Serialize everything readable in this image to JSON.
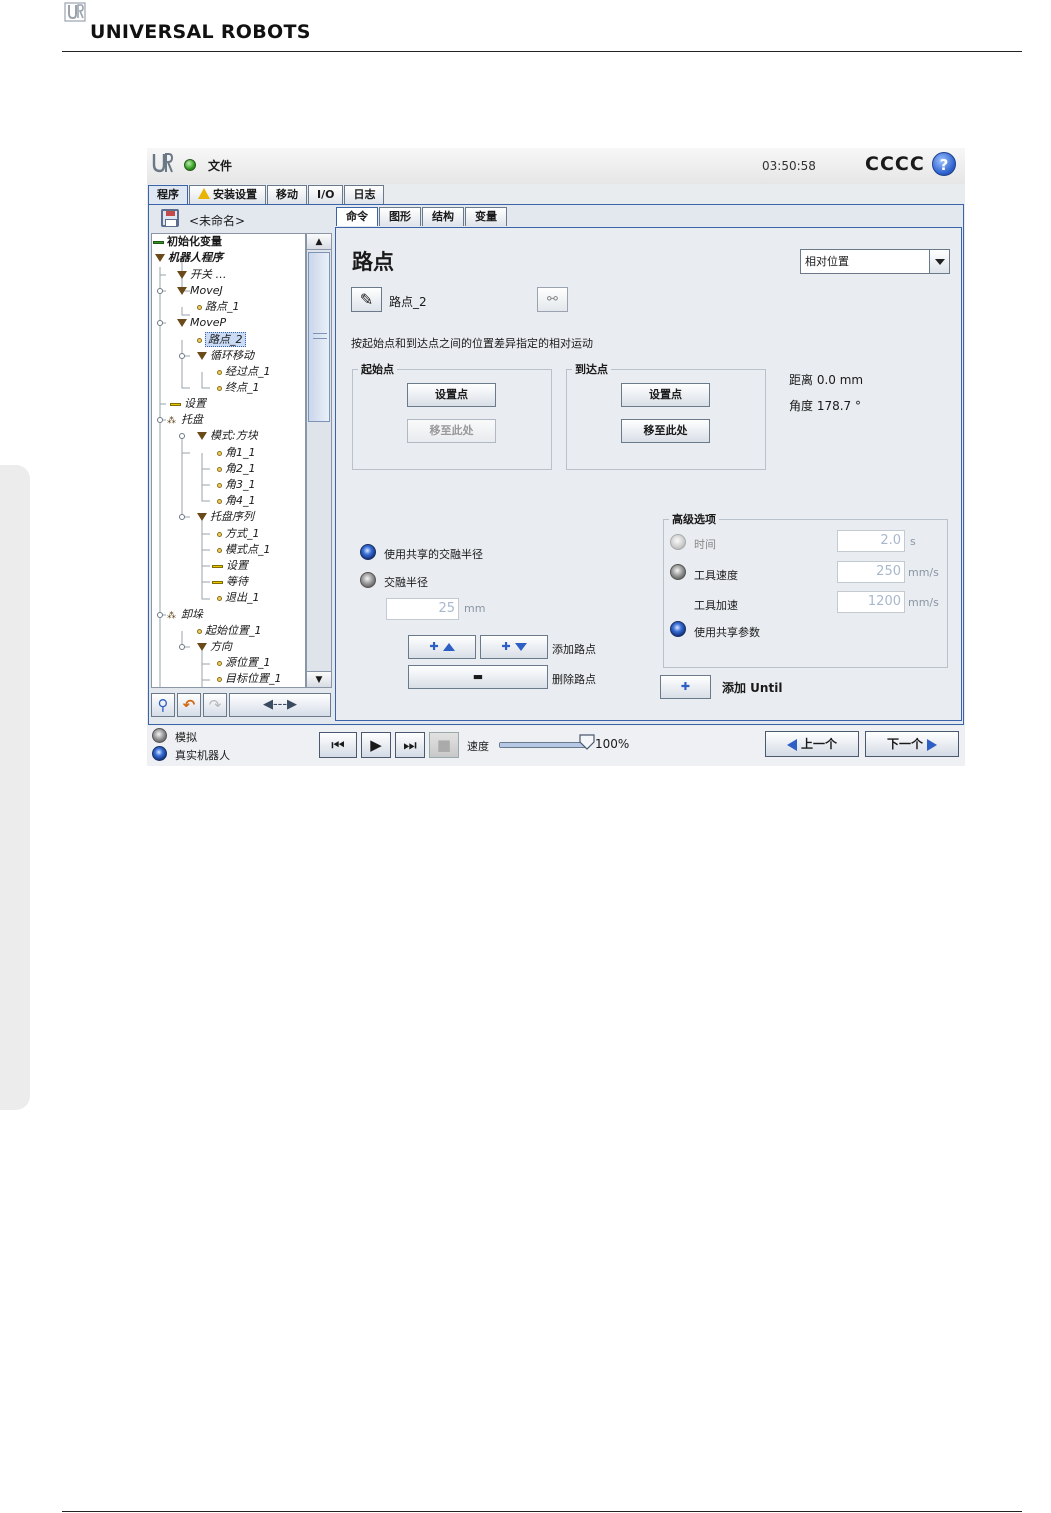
{
  "brand": {
    "name": "UNIVERSAL ROBOTS"
  },
  "titlebar": {
    "file_menu": "文件",
    "time": "03:50:58",
    "robot_name": "CCCC",
    "help": "?"
  },
  "main_tabs": [
    {
      "label": "程序"
    },
    {
      "label": "安装设置"
    },
    {
      "label": "移动"
    },
    {
      "label": "I/O"
    },
    {
      "label": "日志"
    }
  ],
  "program": {
    "name": "<未命名>"
  },
  "tree": [
    {
      "label": "初始化变量"
    },
    {
      "label": "机器人程序"
    },
    {
      "label": "开关 …"
    },
    {
      "label": "MoveJ"
    },
    {
      "label": "路点_1"
    },
    {
      "label": "MoveP"
    },
    {
      "label": "路点_2"
    },
    {
      "label": "循环移动"
    },
    {
      "label": "经过点_1"
    },
    {
      "label": "终点_1"
    },
    {
      "label": "设置"
    },
    {
      "label": "托盘"
    },
    {
      "label": "模式:方块"
    },
    {
      "label": "角1_1"
    },
    {
      "label": "角2_1"
    },
    {
      "label": "角3_1"
    },
    {
      "label": "角4_1"
    },
    {
      "label": "托盘序列"
    },
    {
      "label": "方式_1"
    },
    {
      "label": "模式点_1"
    },
    {
      "label": "设置"
    },
    {
      "label": "等待"
    },
    {
      "label": "退出_1"
    },
    {
      "label": "卸垛"
    },
    {
      "label": "起始位置_1"
    },
    {
      "label": "方向"
    },
    {
      "label": "源位置_1"
    },
    {
      "label": "目标位置_1"
    }
  ],
  "sub_tabs": [
    {
      "label": "命令"
    },
    {
      "label": "图形"
    },
    {
      "label": "结构"
    },
    {
      "label": "变量"
    }
  ],
  "command": {
    "title": "路点",
    "position_mode": "相对位置",
    "waypoint_name": "路点_2",
    "description": "按起始点和到达点之间的位置差异指定的相对运动",
    "from_point": {
      "legend": "起始点",
      "set_button": "设置点",
      "move_button": "移至此处"
    },
    "to_point": {
      "legend": "到达点",
      "set_button": "设置点",
      "move_button": "移至此处"
    },
    "distance": "距离 0.0 mm",
    "angle": "角度 178.7 °",
    "blend_shared": "使用共享的交融半径",
    "blend_radius": "交融半径",
    "blend_value": "25",
    "blend_unit": "mm",
    "add_waypoint": "添加路点",
    "remove_waypoint": "删除路点",
    "advanced": {
      "legend": "高级选项",
      "time_label": "时间",
      "time_value": "2.0",
      "time_unit": "s",
      "tool_speed_label": "工具速度",
      "tool_speed_value": "250",
      "tool_speed_unit": "mm/s",
      "tool_accel_label": "工具加速",
      "tool_accel_value": "1200",
      "tool_accel_unit": "mm/s",
      "shared_params": "使用共享参数"
    },
    "add_until": "添加 Until"
  },
  "bottom": {
    "simulation": "模拟",
    "real_robot": "真实机器人",
    "speed_label": "速度",
    "speed_value": "100%",
    "speed_fraction": 1.0,
    "prev": "上一个",
    "next": "下一个"
  },
  "colors": {
    "accent": "#3b63a8",
    "status_ok": "#2f9a1c",
    "warning": "#e8b400"
  }
}
